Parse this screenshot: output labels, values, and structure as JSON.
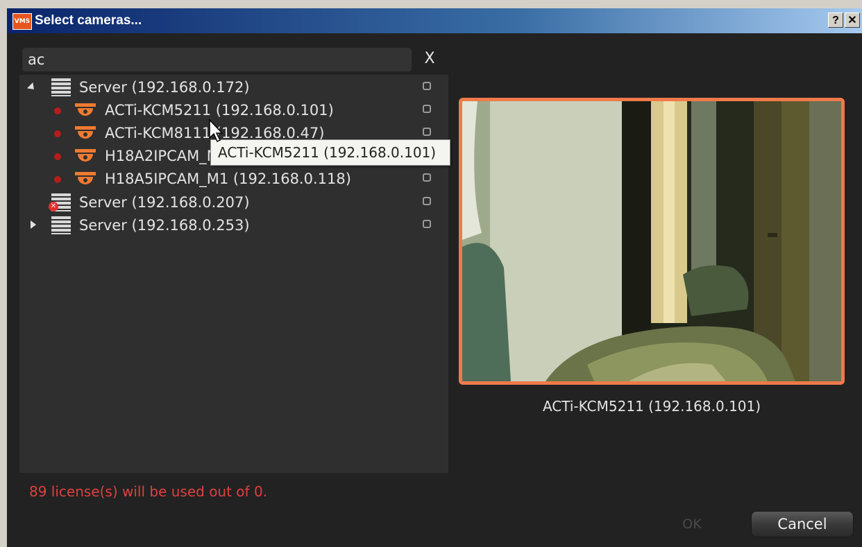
{
  "window": {
    "app_icon_text": "VMS",
    "title": "Select cameras...",
    "help_label": "?",
    "close_label": "✕"
  },
  "search": {
    "value": "ac",
    "clear_label": "X"
  },
  "tree": {
    "servers": [
      {
        "label": "Server (192.168.0.172)",
        "expanded": true,
        "status": "ok",
        "cameras": [
          {
            "label": "ACTi-KCM5211 (192.168.0.101)"
          },
          {
            "label": "ACTi-KCM8111 (192.168.0.47)"
          },
          {
            "label": "H18A2IPCAM_M1 (192.168.0.118)"
          },
          {
            "label": "H18A5IPCAM_M1 (192.168.0.118)"
          }
        ]
      },
      {
        "label": "Server (192.168.0.207)",
        "expanded": false,
        "status": "error"
      },
      {
        "label": "Server (192.168.0.253)",
        "expanded": false,
        "status": "ok"
      }
    ]
  },
  "tooltip": "ACTi-KCM5211 (192.168.0.101)",
  "license_text": "89 license(s) will be used out of 0.",
  "preview": {
    "label": "ACTi-KCM5211 (192.168.0.101)"
  },
  "buttons": {
    "ok": "OK",
    "cancel": "Cancel"
  },
  "colors": {
    "accent": "#f07a4a",
    "license_warning": "#e04040",
    "status_dot": "#b71c1c",
    "camera_icon": "#f07a30"
  }
}
